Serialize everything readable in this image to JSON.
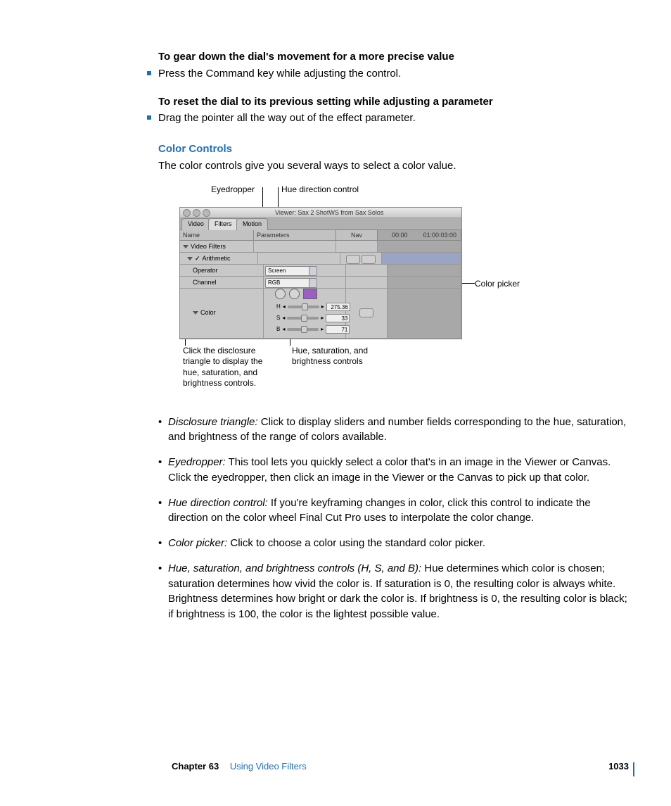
{
  "headings": {
    "h1": "To gear down the dial's movement for a more precise value",
    "b1": "Press the Command key while adjusting the control.",
    "h2": "To reset the dial to its previous setting while adjusting a parameter",
    "b2": "Drag the pointer all the way out of the effect parameter.",
    "section": "Color Controls",
    "section_body": "The color controls give you several ways to select a color value."
  },
  "callouts": {
    "eyedropper": "Eyedropper",
    "hue_dir": "Hue direction control",
    "color_picker": "Color picker",
    "disclosure": "Click the disclosure\ntriangle to display the\nhue, saturation, and\nbrightness controls.",
    "hsb": "Hue, saturation, and\nbrightness controls"
  },
  "screenshot": {
    "viewer_title": "Viewer: Sax 2 ShotWS from Sax Solos",
    "tabs": {
      "video": "Video",
      "filters": "Filters",
      "motion": "Motion"
    },
    "hdr": {
      "name": "Name",
      "param": "Parameters",
      "nav": "Nav"
    },
    "timeline": {
      "start": "00:00",
      "end": "01:00:03:00"
    },
    "rows": {
      "video_filters": "Video Filters",
      "arithmetic": "Arithmetic",
      "operator": "Operator",
      "operator_val": "Screen",
      "channel": "Channel",
      "channel_val": "RGB",
      "color": "Color"
    },
    "hsb": {
      "h_label": "H",
      "h_val": "275.36",
      "s_label": "S",
      "s_val": "33",
      "b_label": "B",
      "b_val": "71"
    }
  },
  "bullets": [
    {
      "term": "Disclosure triangle:",
      "body": "  Click to display sliders and number fields corresponding to the hue, saturation, and brightness of the range of colors available."
    },
    {
      "term": "Eyedropper:",
      "body": "  This tool lets you quickly select a color that's in an image in the Viewer or Canvas. Click the eyedropper, then click an image in the Viewer or the Canvas to pick up that color."
    },
    {
      "term": "Hue direction control:",
      "body": "  If you're keyframing changes in color, click this control to indicate the direction on the color wheel Final Cut Pro uses to interpolate the color change."
    },
    {
      "term": "Color picker:",
      "body": "  Click to choose a color using the standard color picker."
    },
    {
      "term": "Hue, saturation, and brightness controls (H, S, and B):",
      "body": "  Hue determines which color is chosen; saturation determines how vivid the color is. If saturation is 0, the resulting color is always white. Brightness determines how bright or dark the color is. If brightness is 0, the resulting color is black; if brightness is 100, the color is the lightest possible value."
    }
  ],
  "footer": {
    "chapter": "Chapter 63",
    "title": "Using Video Filters",
    "page": "1033"
  }
}
